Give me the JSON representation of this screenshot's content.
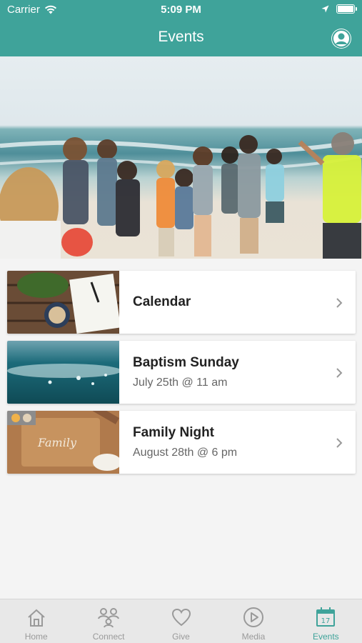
{
  "status_bar": {
    "carrier": "Carrier",
    "time": "5:09 PM"
  },
  "header": {
    "title": "Events"
  },
  "events": [
    {
      "title": "Calendar",
      "subtitle": ""
    },
    {
      "title": "Baptism Sunday",
      "subtitle": "July 25th @ 11 am"
    },
    {
      "title": "Family Night",
      "subtitle": "August 28th @ 6 pm"
    }
  ],
  "tabs": [
    {
      "label": "Home",
      "icon": "home-icon"
    },
    {
      "label": "Connect",
      "icon": "connect-icon"
    },
    {
      "label": "Give",
      "icon": "heart-icon"
    },
    {
      "label": "Media",
      "icon": "play-icon"
    },
    {
      "label": "Events",
      "icon": "calendar-icon",
      "active": true
    }
  ],
  "calendar_icon_day": "17",
  "colors": {
    "brand": "#3fa39a",
    "tab_inactive": "#9a9a9a"
  }
}
